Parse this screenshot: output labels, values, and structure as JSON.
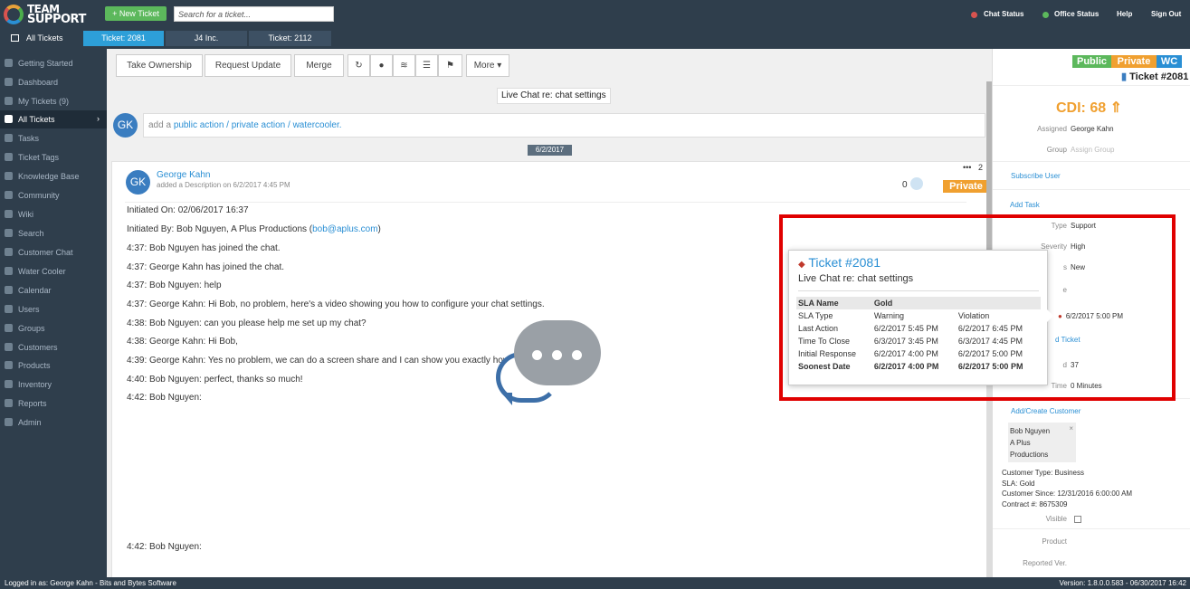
{
  "topbar": {
    "logo_line1": "TEAM",
    "logo_line2": "SUPPORT",
    "new_ticket": "+ New Ticket",
    "search_placeholder": "Search for a ticket...",
    "chat_status": "Chat Status",
    "office_status": "Office Status",
    "help": "Help",
    "sign_out": "Sign Out",
    "chat_status_color": "#d9534f",
    "office_status_color": "#5cb85c"
  },
  "tabs": [
    {
      "label": "All Tickets"
    },
    {
      "label": "Ticket: 2081"
    },
    {
      "label": "J4 Inc."
    },
    {
      "label": "Ticket: 2112"
    }
  ],
  "sidebar": {
    "items": [
      {
        "label": "Getting Started",
        "icon": "arrow-icon"
      },
      {
        "label": "Dashboard",
        "icon": "info-icon"
      },
      {
        "label": "My Tickets (9)",
        "icon": "monitor-icon"
      },
      {
        "label": "All Tickets",
        "icon": "window-icon"
      },
      {
        "label": "Tasks",
        "icon": "check-icon"
      },
      {
        "label": "Ticket Tags",
        "icon": "tag-icon"
      },
      {
        "label": "Knowledge Base",
        "icon": "sitemap-icon"
      },
      {
        "label": "Community",
        "icon": "comments-icon"
      },
      {
        "label": "Wiki",
        "icon": "book-icon"
      },
      {
        "label": "Search",
        "icon": "search-icon"
      },
      {
        "label": "Customer Chat",
        "icon": "chat-icon"
      },
      {
        "label": "Water Cooler",
        "icon": "drop-icon"
      },
      {
        "label": "Calendar",
        "icon": "calendar-icon"
      },
      {
        "label": "Users",
        "icon": "user-icon"
      },
      {
        "label": "Groups",
        "icon": "group-icon"
      },
      {
        "label": "Customers",
        "icon": "card-icon"
      },
      {
        "label": "Products",
        "icon": "box-icon"
      },
      {
        "label": "Inventory",
        "icon": "truck-icon"
      },
      {
        "label": "Reports",
        "icon": "chart-icon"
      },
      {
        "label": "Admin",
        "icon": "gear-icon"
      }
    ],
    "active_chevron": "›"
  },
  "toolbar": {
    "take_ownership": "Take Ownership",
    "request_update": "Request Update",
    "merge": "Merge",
    "more": "More ▾"
  },
  "ticket": {
    "subject": "Live Chat re: chat settings",
    "add_action_prefix": "add a ",
    "public_action": "public action",
    "slash1": " / ",
    "private_action": "private action",
    "slash2": " / ",
    "watercooler": "watercooler.",
    "avatar_initials": "GK",
    "date_separator": "6/2/2017"
  },
  "action": {
    "author": "George Kahn",
    "subline": "added a Description on 6/2/2017 4:45 PM",
    "count": "0",
    "more_count": "2",
    "private_badge": "Private",
    "lines": [
      "Initiated On: 02/06/2017 16:37",
      "Initiated By: Bob Nguyen, A Plus Productions (",
      "4:37: Bob Nguyen has joined the chat.",
      "4:37: George Kahn has joined the chat.",
      "4:37: Bob Nguyen: help",
      "4:37: George Kahn: Hi Bob, no problem, here's a video showing you how to configure your chat settings.",
      "4:38: Bob Nguyen: can you please help me set up my chat?",
      "4:38: George Kahn: Hi Bob,",
      "4:39: George Kahn: Yes no problem, we can do a screen share and I can show you exactly how to configure chat",
      "4:40: Bob Nguyen: perfect, thanks so much!",
      "4:42: Bob Nguyen:"
    ],
    "email": "bob@aplus.com",
    "email_close": ")",
    "last_line": "4:42: Bob Nguyen:"
  },
  "right_panel": {
    "vis_public": "Public",
    "vis_private": "Private",
    "vis_wc": "WC",
    "ticket_number": "Ticket #2081",
    "cdi": "CDI: 68 ⇑",
    "assigned_label": "Assigned",
    "assigned_value": "George Kahn",
    "group_label": "Group",
    "group_value": "Assign Group",
    "subscribe": "Subscribe User",
    "add_task": "Add Task",
    "type_label": "Type",
    "type_value": "Support",
    "severity_label": "Severity",
    "severity_value": "High",
    "status_label": "s",
    "status_value": "New",
    "partial_e": "e",
    "due_value": "6/2/2017 5:00 PM",
    "related_ticket": "d Ticket",
    "partial_d": "d",
    "days_value": "37",
    "time_label": "Time",
    "time_value": "0 Minutes",
    "add_customer": "Add/Create Customer",
    "cust_line1": "Bob Nguyen",
    "cust_line2": "A Plus",
    "cust_line3": "Productions",
    "cust_close": "×",
    "customer_type": "Customer Type: Business",
    "sla": "SLA: Gold",
    "customer_since": "Customer Since: 12/31/2016 6:00:00 AM",
    "contract": "Contract #: 8675309",
    "visible_label": "Visible",
    "product_label": "Product",
    "reported_label": "Reported Ver."
  },
  "popup": {
    "title": "Ticket #2081",
    "subtitle": "Live Chat re: chat settings",
    "header": [
      "SLA Name",
      "Gold",
      ""
    ],
    "rows": [
      [
        "SLA Type",
        "Warning",
        "Violation"
      ],
      [
        "Last Action",
        "6/2/2017 5:45 PM",
        "6/2/2017 6:45 PM"
      ],
      [
        "Time To Close",
        "6/3/2017 3:45 PM",
        "6/3/2017 4:45 PM"
      ],
      [
        "Initial Response",
        "6/2/2017 4:00 PM",
        "6/2/2017 5:00 PM"
      ]
    ],
    "soonest": [
      "Soonest Date",
      "6/2/2017 4:00 PM",
      "6/2/2017 5:00 PM"
    ]
  },
  "statusbar": {
    "left": "Logged in as: George Kahn - Bits and Bytes Software",
    "right": "Version: 1.8.0.0.583 - 06/30/2017 16:42"
  },
  "colors": {
    "nav_bg": "#2f3e4c",
    "accent_blue": "#2a8fd4",
    "new_ticket_green": "#5cb85c",
    "private_orange": "#f0a030",
    "highlight_red": "#e00000"
  }
}
